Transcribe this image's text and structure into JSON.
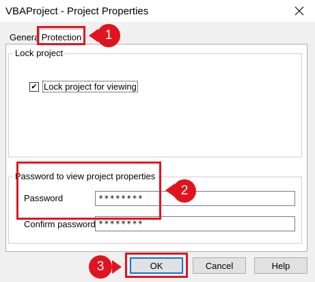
{
  "window": {
    "title": "VBAProject - Project Properties"
  },
  "tabs": [
    {
      "label": "General"
    },
    {
      "label": "Protection"
    }
  ],
  "lock_group": {
    "title": "Lock project",
    "checkbox_label": "Lock project for viewing",
    "checked": true
  },
  "password_group": {
    "title": "Password to view project properties",
    "password_label": "Password",
    "password_value": "********",
    "confirm_label": "Confirm password",
    "confirm_value": "********"
  },
  "buttons": {
    "ok": "OK",
    "cancel": "Cancel",
    "help": "Help"
  },
  "annotations": {
    "accent_color": "#e0141f",
    "badges": [
      "1",
      "2",
      "3"
    ]
  }
}
